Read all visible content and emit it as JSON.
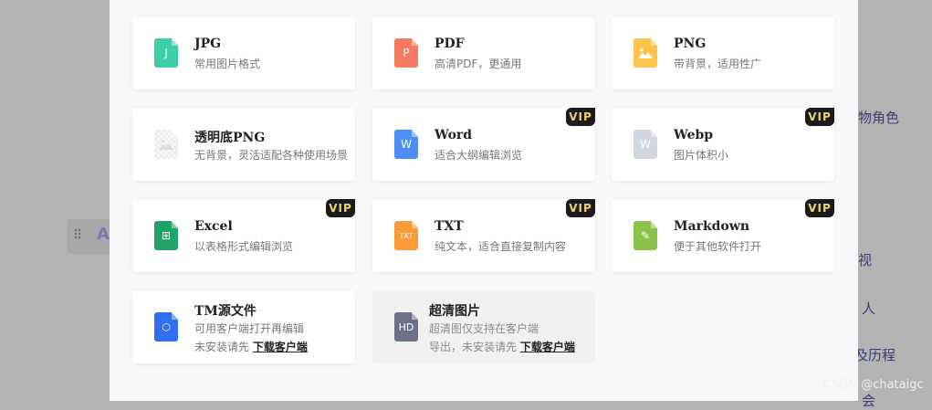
{
  "background": {
    "handle_dots": "⠿",
    "handle_letter": "A",
    "right_texts": [
      "物角色",
      "视",
      "人",
      "及历程",
      "会"
    ]
  },
  "watermark": "CSDN @chataigc",
  "vip_label": "VIP",
  "cards": [
    {
      "title": "JPG",
      "desc": "常用图片格式",
      "icon_text": "J",
      "icon": "jpg-file-icon",
      "color": "#3ccfa7"
    },
    {
      "title": "PDF",
      "desc": "高清PDF，更通用",
      "icon_text": "P",
      "icon": "pdf-file-icon",
      "color": "#f57a62"
    },
    {
      "title": "PNG",
      "desc": "带背景，适用性广",
      "icon_text": "",
      "icon": "png-file-icon",
      "color": "#fcc44c"
    },
    {
      "title": "透明底PNG",
      "desc": "无背景，灵活适配各种使用场景",
      "icon_text": "",
      "icon": "transparent-png-file-icon",
      "color": "#e9e9e9"
    },
    {
      "title": "Word",
      "desc": "适合大纲编辑浏览",
      "icon_text": "W",
      "icon": "word-file-icon",
      "color": "#4e8df5",
      "vip": true
    },
    {
      "title": "Webp",
      "desc": "图片体积小",
      "icon_text": "W",
      "icon": "webp-file-icon",
      "color": "#d1d7e0",
      "vip": true
    },
    {
      "title": "Excel",
      "desc": "以表格形式编辑浏览",
      "icon_text": "⊞",
      "icon": "excel-file-icon",
      "color": "#21a365",
      "vip": true
    },
    {
      "title": "TXT",
      "desc": "纯文本，适合直接复制内容",
      "icon_text": "TXT",
      "icon": "txt-file-icon",
      "color": "#fb9b3a",
      "vip": true
    },
    {
      "title": "Markdown",
      "desc": "便于其他软件打开",
      "icon_text": "✎",
      "icon": "markdown-file-icon",
      "color": "#8bc34a",
      "vip": true
    },
    {
      "title": "TM源文件",
      "desc": "可用客户端打开再编辑",
      "desc2_prefix": "未安装请先 ",
      "desc2_link": "下载客户端",
      "icon_text": "⬡",
      "icon": "tm-file-icon",
      "color": "#3070f0"
    },
    {
      "title": "超清图片",
      "desc": "超清图仅支持在客户端",
      "desc2_prefix": "导出，未安装请先 ",
      "desc2_link": "下载客户端",
      "icon_text": "HD",
      "icon": "hd-file-icon",
      "color": "#6d7089",
      "disabled": true
    }
  ]
}
